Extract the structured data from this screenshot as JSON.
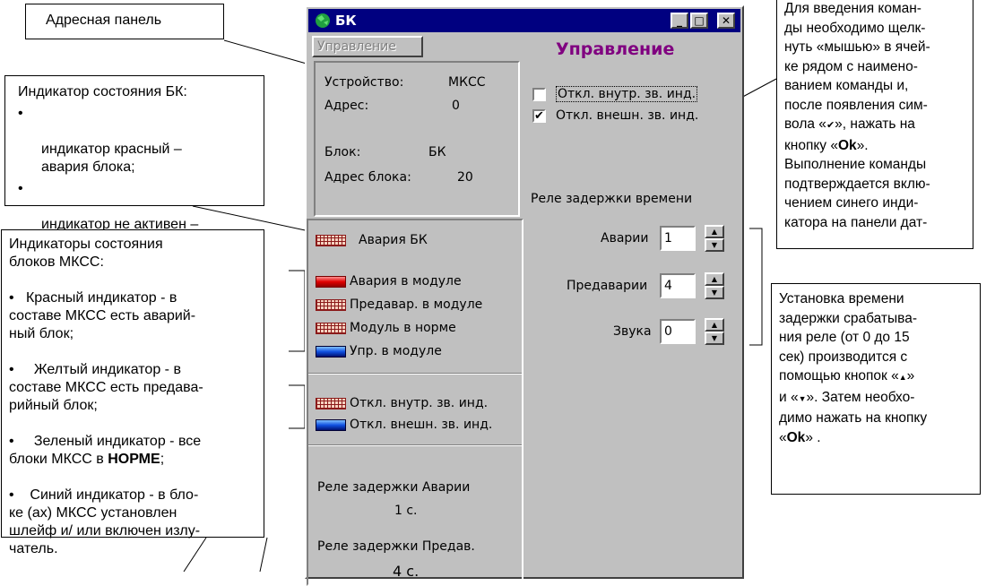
{
  "callouts": {
    "address_panel": "Адресная панель",
    "status_indicator": {
      "title": "Индикатор состояния  БК:",
      "items": [
        "индикатор красный –\nавария блока;",
        "индикатор не активен –\nблок в норме."
      ]
    },
    "module_indicators": {
      "title": "Индикаторы состояния\nблоков МКСС:",
      "items": [
        "Красный индикатор - в\nсоставе МКСС есть аварий-\nный блок;",
        "Желтый индикатор - в\nсоставе МКСС есть предава-\nрийный блок;",
        "Зеленый индикатор - все\nблоки МКСС в ",
        "Синий индикатор - в бло-\nке (ах) МКСС установлен\nшлейф и/ или включен излу-\nчатель."
      ],
      "bold_word": "НОРМЕ",
      "after_bold": ";"
    },
    "commands": {
      "part1": "Для введения коман-\nды необходимо щелк-\nнуть «мышью» в ячей-\nке рядом с наимено-\nванием команды и,\nпосле появления сим-\nвола «",
      "check_glyph": "✔",
      "part2": "», нажать на\nкнопку «",
      "ok_label": "Ok",
      "part3": "».\nВыполнение команды\nподтверждается вклю-\nчением синего инди-\nкатора на панели дат-"
    },
    "delay_setting": {
      "part1": "Установка времени\nзадержки  срабатыва-\nния реле (от 0 до 15\nсек) производится с\nпомощью кнопок «",
      "up_glyph": "▲",
      "part2": "»\nи «",
      "down_glyph": "▼",
      "part3": "».  Затем необхо-\nдимо нажать на кнопку\n«",
      "ok_label": "Ok",
      "part4": "» ."
    },
    "bullet_glyph": "•"
  },
  "window": {
    "title": "БК",
    "buttons": {
      "minimize": "_",
      "maximize": "□",
      "close": "✕"
    },
    "control_button": "Управление",
    "control_heading": "Управление",
    "info": {
      "device_label": "Устройство:",
      "device_value": "МКСС",
      "address_label": "Адрес:",
      "address_value": "0",
      "block_label": "Блок:",
      "block_value": "БК",
      "block_address_label": "Адрес блока:",
      "block_address_value": "20"
    },
    "alarm_bk": "Авария БК",
    "module_status": [
      {
        "label": "Авария  в  модуле",
        "color": "red"
      },
      {
        "label": "Предавар. в модуле",
        "color": "grid"
      },
      {
        "label": "Модуль  в  норме",
        "color": "grid"
      },
      {
        "label": "Упр. в модуле",
        "color": "blue"
      }
    ],
    "sound_status": [
      {
        "label": "Откл.  внутр. зв. инд.",
        "color": "grid"
      },
      {
        "label": "Откл. внешн. зв. инд.",
        "color": "blue"
      }
    ],
    "delay_alarm_label": "Реле задержки Аварии",
    "delay_alarm_value": "1   с.",
    "delay_prealarm_label": "Реле задержки Предав.",
    "delay_prealarm_value": "4   с.",
    "commands": [
      {
        "label": "Откл.  внутр. зв. инд.",
        "checked": false
      },
      {
        "label": "Откл. внешн. зв. инд.",
        "checked": true
      }
    ],
    "check_mark": "✔",
    "relay_heading": "Реле задержки времени",
    "spinners": [
      {
        "label": "Аварии",
        "value": "1"
      },
      {
        "label": "Предаварии",
        "value": "4"
      },
      {
        "label": "Звука",
        "value": "0"
      }
    ],
    "spin_up": "▲",
    "spin_down": "▼"
  }
}
